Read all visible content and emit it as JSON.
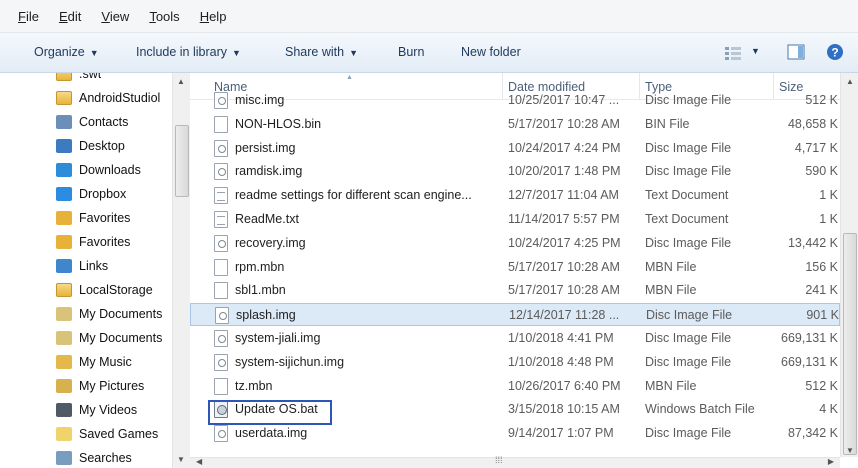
{
  "menu": [
    "File",
    "Edit",
    "View",
    "Tools",
    "Help"
  ],
  "menu_underline": [
    "F",
    "E",
    "V",
    "T",
    "H"
  ],
  "toolbar": {
    "organize": "Organize",
    "include_library": "Include in library",
    "share_with": "Share with",
    "burn": "Burn",
    "new_folder": "New folder"
  },
  "nav": [
    {
      "label": ".swt",
      "icon": "folder-icon"
    },
    {
      "label": "AndroidStudiol",
      "icon": "folder-icon"
    },
    {
      "label": "Contacts",
      "icon": "contacts-icon"
    },
    {
      "label": "Desktop",
      "icon": "desktop-icon"
    },
    {
      "label": "Downloads",
      "icon": "downloads-icon"
    },
    {
      "label": "Dropbox",
      "icon": "dropbox-icon"
    },
    {
      "label": "Favorites",
      "icon": "favorites-icon"
    },
    {
      "label": "Favorites",
      "icon": "favorites-icon"
    },
    {
      "label": "Links",
      "icon": "links-icon"
    },
    {
      "label": "LocalStorage",
      "icon": "folder-icon"
    },
    {
      "label": "My Documents",
      "icon": "documents-icon"
    },
    {
      "label": "My Documents",
      "icon": "documents-icon"
    },
    {
      "label": "My Music",
      "icon": "music-icon"
    },
    {
      "label": "My Pictures",
      "icon": "pictures-icon"
    },
    {
      "label": "My Videos",
      "icon": "videos-icon"
    },
    {
      "label": "Saved Games",
      "icon": "games-icon"
    },
    {
      "label": "Searches",
      "icon": "search-icon"
    }
  ],
  "columns": {
    "name": "Name",
    "date": "Date modified",
    "type": "Type",
    "size": "Size"
  },
  "files": [
    {
      "name": "misc.img",
      "date": "10/25/2017 10:47 ...",
      "type": "Disc Image File",
      "size": "512 K",
      "icon": "img"
    },
    {
      "name": "NON-HLOS.bin",
      "date": "5/17/2017 10:28 AM",
      "type": "BIN File",
      "size": "48,658 K",
      "icon": "file"
    },
    {
      "name": "persist.img",
      "date": "10/24/2017 4:24 PM",
      "type": "Disc Image File",
      "size": "4,717 K",
      "icon": "img"
    },
    {
      "name": "ramdisk.img",
      "date": "10/20/2017 1:48 PM",
      "type": "Disc Image File",
      "size": "590 K",
      "icon": "img"
    },
    {
      "name": "readme settings for different scan engine...",
      "date": "12/7/2017 11:04 AM",
      "type": "Text Document",
      "size": "1 K",
      "icon": "txt"
    },
    {
      "name": "ReadMe.txt",
      "date": "11/14/2017 5:57 PM",
      "type": "Text Document",
      "size": "1 K",
      "icon": "txt"
    },
    {
      "name": "recovery.img",
      "date": "10/24/2017 4:25 PM",
      "type": "Disc Image File",
      "size": "13,442 K",
      "icon": "img"
    },
    {
      "name": "rpm.mbn",
      "date": "5/17/2017 10:28 AM",
      "type": "MBN File",
      "size": "156 K",
      "icon": "file"
    },
    {
      "name": "sbl1.mbn",
      "date": "5/17/2017 10:28 AM",
      "type": "MBN File",
      "size": "241 K",
      "icon": "file"
    },
    {
      "name": "splash.img",
      "date": "12/14/2017 11:28 ...",
      "type": "Disc Image File",
      "size": "901 K",
      "icon": "img",
      "selected": true
    },
    {
      "name": "system-jiali.img",
      "date": "1/10/2018 4:41 PM",
      "type": "Disc Image File",
      "size": "669,131 K",
      "icon": "img"
    },
    {
      "name": "system-sijichun.img",
      "date": "1/10/2018 4:48 PM",
      "type": "Disc Image File",
      "size": "669,131 K",
      "icon": "img"
    },
    {
      "name": "tz.mbn",
      "date": "10/26/2017 6:40 PM",
      "type": "MBN File",
      "size": "512 K",
      "icon": "file"
    },
    {
      "name": "Update OS.bat",
      "date": "3/15/2018 10:15 AM",
      "type": "Windows Batch File",
      "size": "4 K",
      "icon": "bat",
      "highlighted": true
    },
    {
      "name": "userdata.img",
      "date": "9/14/2017 1:07 PM",
      "type": "Disc Image File",
      "size": "87,342 K",
      "icon": "img"
    }
  ],
  "colors": {
    "accent": "#2e55b8",
    "selection": "#dce9f7",
    "toolbar_text": "#1e395b"
  }
}
